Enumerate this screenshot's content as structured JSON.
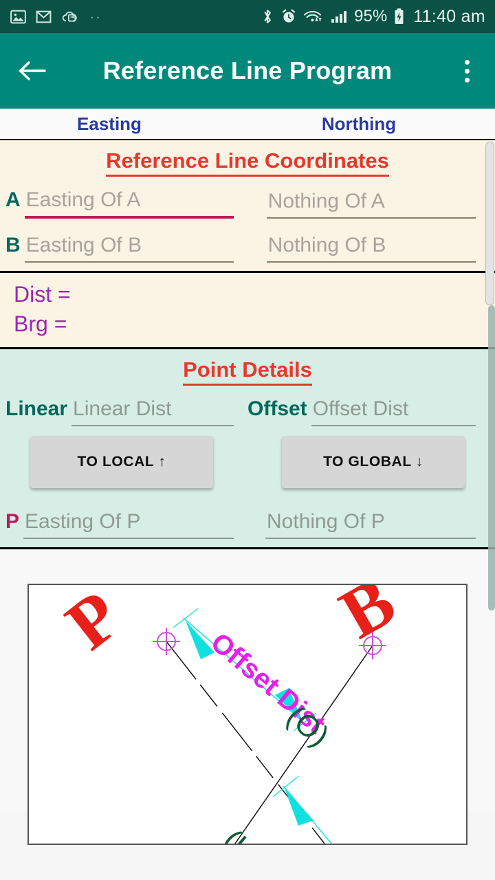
{
  "statusbar": {
    "icons_left": [
      "photos-icon",
      "gmail-icon",
      "cloud-sync-icon",
      "more-dots-icon"
    ],
    "icons_right": [
      "bluetooth-icon",
      "alarm-icon",
      "wifi-icon",
      "signal-icon",
      "battery-charging-icon"
    ],
    "battery_percent": "95%",
    "time": "11:40 am"
  },
  "appbar": {
    "back_icon": "arrow-left-icon",
    "title": "Reference Line Program",
    "overflow_icon": "more-vertical-icon"
  },
  "columns": {
    "easting": "Easting",
    "northing": "Northing"
  },
  "reference": {
    "title": "Reference Line Coordinates",
    "rows": [
      {
        "label": "A",
        "easting_placeholder": "Easting Of A",
        "easting_value": "",
        "northing_placeholder": "Nothing Of A",
        "northing_value": ""
      },
      {
        "label": "B",
        "easting_placeholder": "Easting Of B",
        "easting_value": "",
        "northing_placeholder": "Nothing Of B",
        "northing_value": ""
      }
    ]
  },
  "results": {
    "dist": "Dist =",
    "brg": "Brg ="
  },
  "point_details": {
    "title": "Point Details",
    "linear_label": "Linear",
    "linear_placeholder": "Linear Dist",
    "linear_value": "",
    "offset_label": "Offset",
    "offset_placeholder": "Offset Dist",
    "offset_value": "",
    "to_local_button": "TO LOCAL ↑",
    "to_global_button": "TO GLOBAL ↓",
    "p_label": "P",
    "p_easting_placeholder": "Easting Of P",
    "p_easting_value": "",
    "p_northing_placeholder": "Nothing Of P",
    "p_northing_value": ""
  },
  "diagram": {
    "name": "reference-line-offset-diagram",
    "point_p": "P",
    "point_b": "B",
    "offset_label": "Offset Dist",
    "offset_symbol": "(O)"
  },
  "colors": {
    "status_bar": "#095245",
    "app_bar": "#00897b",
    "section_cream": "#fbf3e4",
    "section_mint": "#d6eee5",
    "title_red": "#e03b2e",
    "label_teal": "#00695c",
    "label_pink": "#c2185b",
    "result_purple": "#9b27b0",
    "column_blue": "#2b3a9e",
    "diagram_red": "#e8201a",
    "diagram_magenta": "#e020e0",
    "diagram_cyan": "#18e0e0",
    "diagram_green": "#0b5c34"
  }
}
